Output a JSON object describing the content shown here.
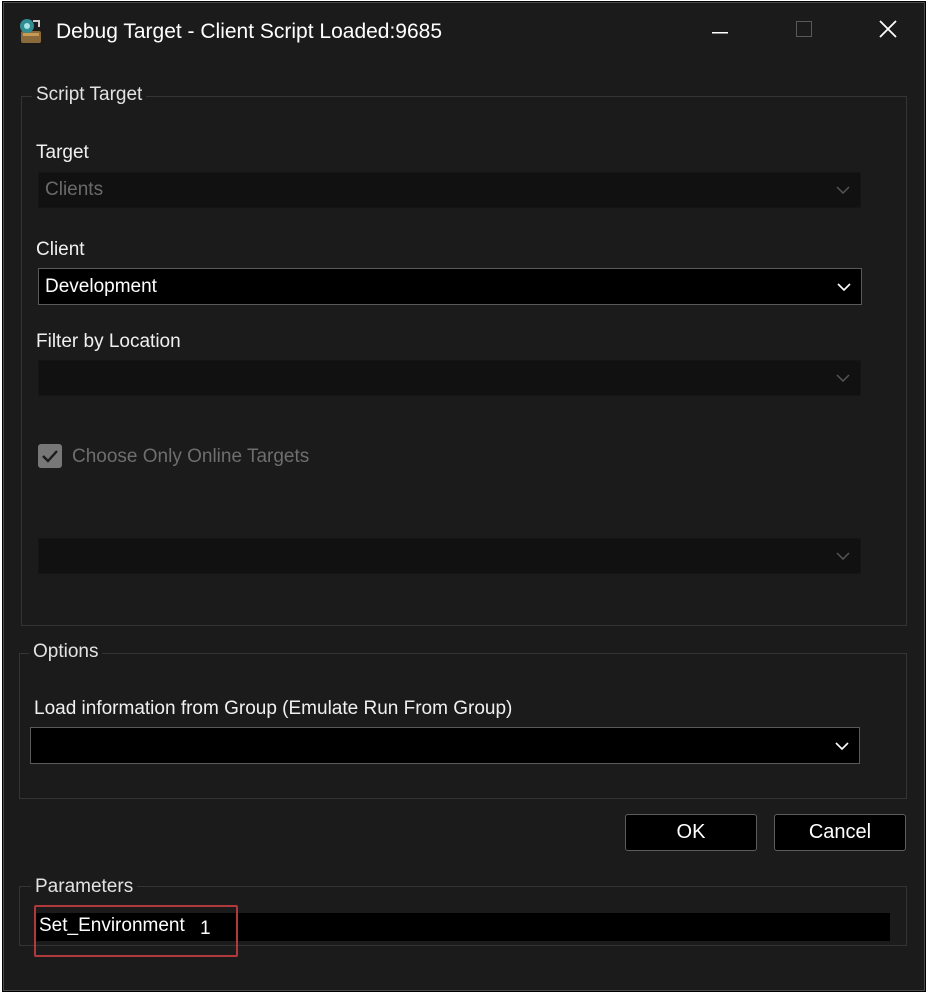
{
  "window": {
    "title": "Debug Target - Client Script Loaded:9685"
  },
  "script_target": {
    "group_label": "Script Target",
    "target": {
      "label": "Target",
      "value": "Clients"
    },
    "client": {
      "label": "Client",
      "value": "Development"
    },
    "filter_location": {
      "label": "Filter by Location",
      "value": ""
    },
    "online_checkbox": {
      "label": "Choose Only Online Targets",
      "checked": true
    },
    "target_select": {
      "value": ""
    }
  },
  "options": {
    "group_label": "Options",
    "load_group": {
      "label": "Load information from Group (Emulate Run From Group)",
      "value": ""
    }
  },
  "buttons": {
    "ok": "OK",
    "cancel": "Cancel"
  },
  "parameters": {
    "group_label": "Parameters",
    "items": [
      {
        "name": "Set_Environment",
        "value": "1"
      }
    ]
  },
  "colors": {
    "window_bg": "#1b1b1b",
    "field_bg": "#000000",
    "highlight": "#b0393c"
  },
  "icons": [
    "app-icon",
    "minimize-icon",
    "maximize-icon",
    "close-icon",
    "chevron-down-icon",
    "checkmark-icon"
  ]
}
